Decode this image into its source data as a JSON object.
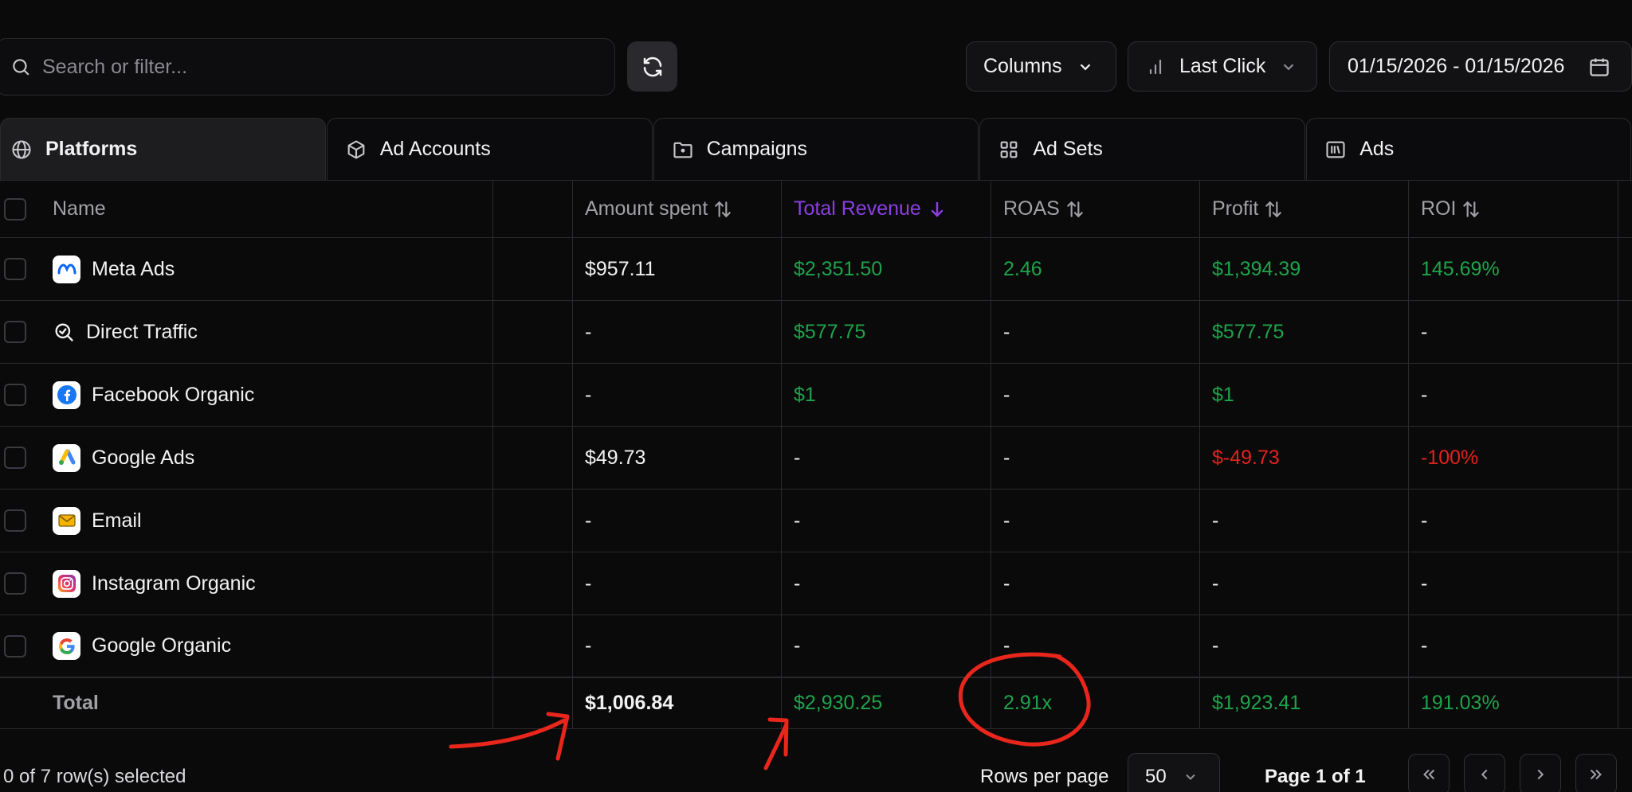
{
  "toolbar": {
    "search_placeholder": "Search or filter...",
    "columns_label": "Columns",
    "attribution_label": "Last Click",
    "date_range": "01/15/2026 - 01/15/2026"
  },
  "tabs": [
    {
      "label": "Platforms",
      "icon": "globe-icon",
      "active": true
    },
    {
      "label": "Ad Accounts",
      "icon": "cube-icon",
      "active": false
    },
    {
      "label": "Campaigns",
      "icon": "folder-icon",
      "active": false
    },
    {
      "label": "Ad Sets",
      "icon": "grid-icon",
      "active": false
    },
    {
      "label": "Ads",
      "icon": "library-icon",
      "active": false
    }
  ],
  "table": {
    "headers": {
      "name": "Name",
      "amount_spent": "Amount spent",
      "total_revenue": "Total Revenue",
      "roas": "ROAS",
      "profit": "Profit",
      "roi": "ROI"
    },
    "rows": [
      {
        "name": "Meta Ads",
        "icon": "meta-logo-icon",
        "amount_spent": "$957.11",
        "total_revenue": "$2,351.50",
        "roas": "2.46",
        "profit": "$1,394.39",
        "roi": "145.69%"
      },
      {
        "name": "Direct Traffic",
        "icon": "direct-traffic-icon",
        "amount_spent": "-",
        "total_revenue": "$577.75",
        "roas": "-",
        "profit": "$577.75",
        "roi": "-"
      },
      {
        "name": "Facebook Organic",
        "icon": "facebook-logo-icon",
        "amount_spent": "-",
        "total_revenue": "$1",
        "roas": "-",
        "profit": "$1",
        "roi": "-"
      },
      {
        "name": "Google Ads",
        "icon": "google-ads-logo-icon",
        "amount_spent": "$49.73",
        "total_revenue": "-",
        "roas": "-",
        "profit": "$-49.73",
        "roi": "-100%"
      },
      {
        "name": "Email",
        "icon": "email-icon",
        "amount_spent": "-",
        "total_revenue": "-",
        "roas": "-",
        "profit": "-",
        "roi": "-"
      },
      {
        "name": "Instagram Organic",
        "icon": "instagram-logo-icon",
        "amount_spent": "-",
        "total_revenue": "-",
        "roas": "-",
        "profit": "-",
        "roi": "-"
      },
      {
        "name": "Google Organic",
        "icon": "google-logo-icon",
        "amount_spent": "-",
        "total_revenue": "-",
        "roas": "-",
        "profit": "-",
        "roi": "-"
      }
    ],
    "total": {
      "label": "Total",
      "amount_spent": "$1,006.84",
      "total_revenue": "$2,930.25",
      "roas": "2.91x",
      "profit": "$1,923.41",
      "roi": "191.03%"
    }
  },
  "footer": {
    "selection_text": "0 of 7 row(s) selected",
    "rows_per_page_label": "Rows per page",
    "rows_per_page_value": "50",
    "page_text": "Page 1 of 1"
  },
  "colors": {
    "background": "#0a0a0b",
    "positive": "#1fa34a",
    "negative": "#e0221f",
    "sorted_header": "#8b3fe0",
    "annotation": "#e8261c"
  }
}
